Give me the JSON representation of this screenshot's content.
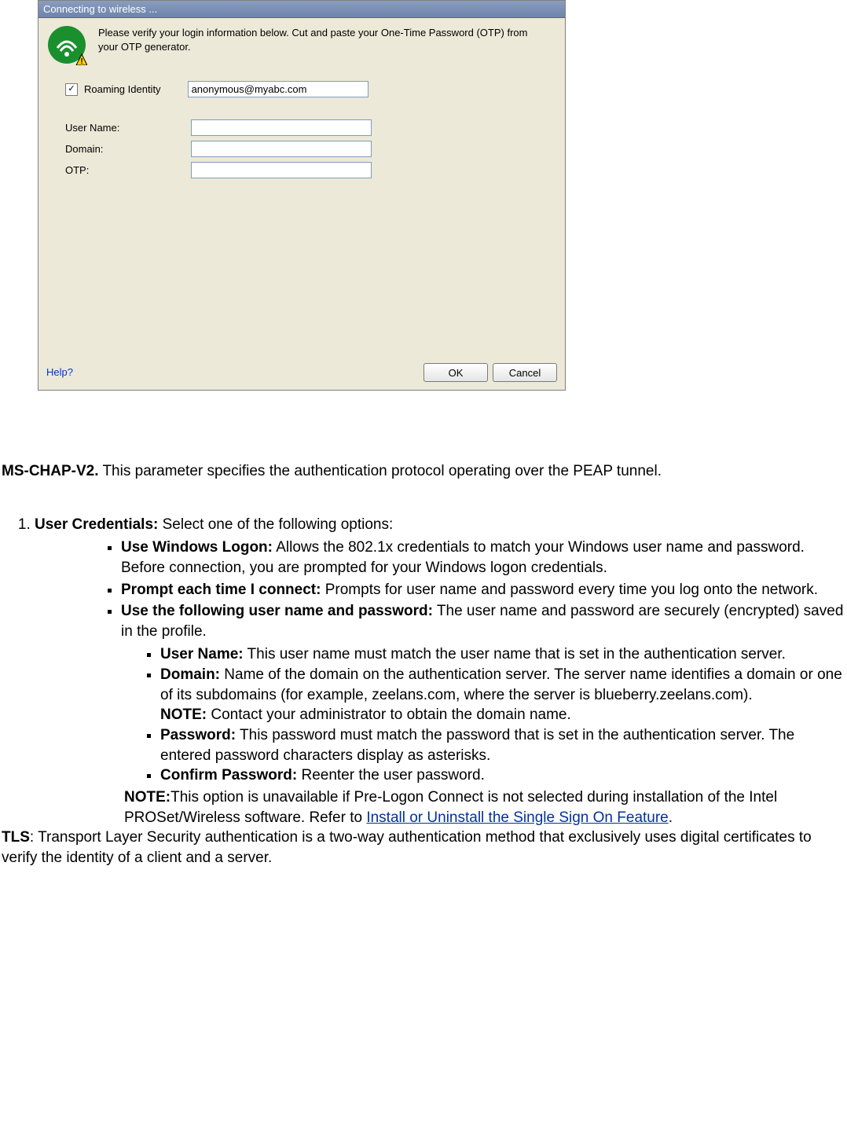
{
  "dialog": {
    "title": "Connecting to wireless ...",
    "instruction": "Please verify your login information below. Cut and paste your One-Time Password (OTP) from your OTP generator.",
    "roaming": {
      "checked": true,
      "label": "Roaming Identity",
      "value": "anonymous@myabc.com"
    },
    "fields": {
      "username_label": "User Name:",
      "username_value": "",
      "domain_label": "Domain:",
      "domain_value": "",
      "otp_label": "OTP:",
      "otp_value": ""
    },
    "help_label": "Help?",
    "ok_label": "OK",
    "cancel_label": "Cancel"
  },
  "doc": {
    "mschap_heading": "MS-CHAP-V2.",
    "mschap_text": " This parameter specifies the authentication protocol operating over the PEAP tunnel.",
    "usercred_heading": "User Credentials:",
    "usercred_text": " Select one of the following options:",
    "win_logon_heading": "Use Windows Logon:",
    "win_logon_text": " Allows the 802.1x credentials to match your Windows user name and password. Before connection, you are prompted for your Windows logon credentials.",
    "prompt_heading": "Prompt each time I connect:",
    "prompt_text": " Prompts for user name and password every time you log onto the network.",
    "usefollowing_heading": "Use the following user name and password:",
    "usefollowing_text": " The user name and password are securely (encrypted) saved in the profile.",
    "username_heading": "User Name:",
    "username_text": " This user name must match the user name that is set in the authentication server.",
    "domain_heading": "Domain:",
    "domain_text_a": " Name of the domain on the authentication server. The server name identifies a domain or one of its subdomains (for example, zeelans.com, where the server is blueberry.zeelans.com). ",
    "domain_note_heading": "NOTE:",
    "domain_note_text": " Contact your administrator to obtain the domain name.",
    "password_heading": "Password:",
    "password_text": " This password must match the password that is set in the authentication server. The entered password characters display as asterisks.",
    "confirm_heading": "Confirm Password:",
    "confirm_text": " Reenter the user password.",
    "note2_heading": "NOTE:",
    "note2_text_a": "This option is unavailable if Pre-Logon Connect is not selected during installation of the Intel PROSet/Wireless software. Refer to ",
    "note2_link": "Install or Uninstall the Single Sign On Feature",
    "note2_text_b": ".",
    "tls_heading": "TLS",
    "tls_text": ": Transport Layer Security authentication is a two-way authentication method that exclusively uses digital certificates to verify the identity of a client and a server."
  }
}
